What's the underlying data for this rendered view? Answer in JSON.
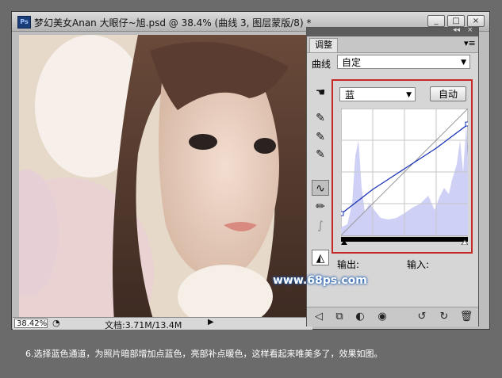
{
  "window": {
    "app_logo": "Ps",
    "title": "梦幻美女Anan 大眼仔~旭.psd @ 38.4% (曲线 3, 图层蒙版/8) *",
    "minimize": "_",
    "maximize": "□",
    "close": "×"
  },
  "status": {
    "zoom": "38.42%",
    "doc": "文档:3.71M/13.4M"
  },
  "panel": {
    "tab": "调整",
    "curve_label": "曲线",
    "preset": "自定",
    "channel": "蓝",
    "auto_label": "自动",
    "output_label": "输出:",
    "input_label": "输入:"
  },
  "watermark": "www.68ps.com",
  "caption": "6.选择蓝色通道，为照片暗部增加点蓝色，亮部补点暖色，这样看起来唯美多了，效果如图。",
  "colors": {
    "highlight_border": "#c62828",
    "curve_line": "#1a33b8",
    "histogram": "#cfd0f5"
  }
}
